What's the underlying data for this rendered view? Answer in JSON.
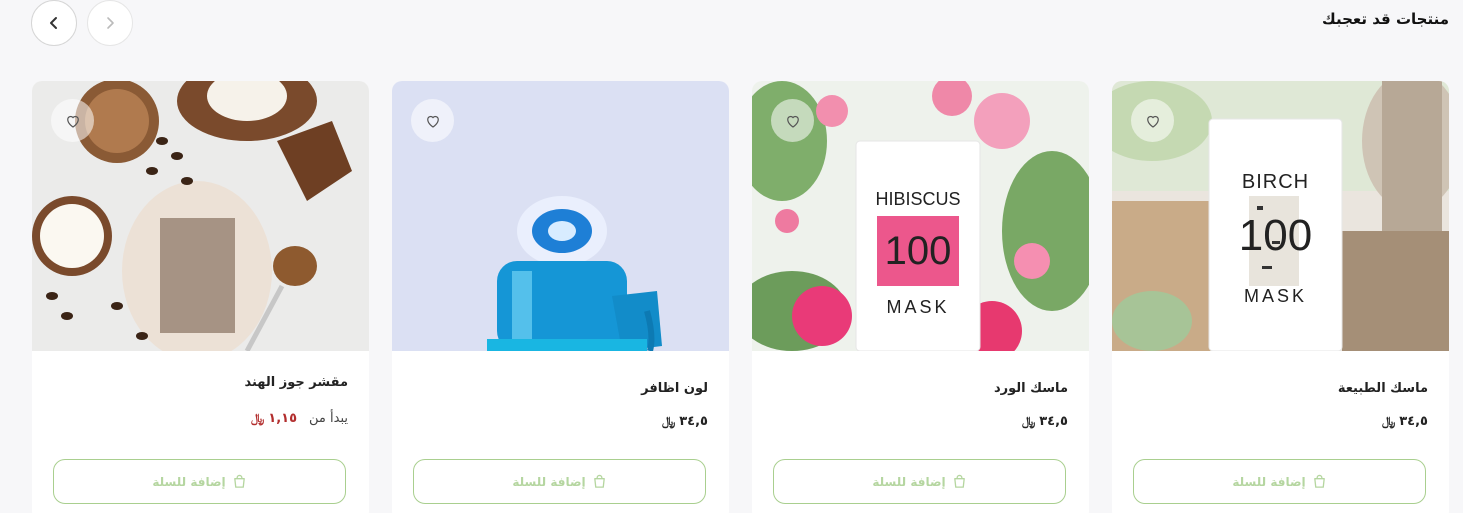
{
  "section": {
    "title": "منتجات قد تعجبك"
  },
  "nav": {
    "prev_icon": "chevron-left-icon",
    "next_icon": "chevron-right-icon"
  },
  "colors": {
    "accent": "#a9cf8f",
    "sale": "#b22d2d"
  },
  "products": [
    {
      "name": "ماسك الطبيعة",
      "price_prefix": "",
      "price": "٣٤,٥",
      "currency": "﷼",
      "sale": false,
      "add_label": "إضافة للسلة",
      "image_texts": {
        "top": "BIRCH",
        "number": "100",
        "bottom": "MASK"
      }
    },
    {
      "name": "ماسك الورد",
      "price_prefix": "",
      "price": "٣٤,٥",
      "currency": "﷼",
      "sale": false,
      "add_label": "إضافة للسلة",
      "image_texts": {
        "top": "HIBISCUS",
        "number": "100",
        "bottom": "MASK"
      }
    },
    {
      "name": "لون اظافر",
      "price_prefix": "",
      "price": "٣٤,٥",
      "currency": "﷼",
      "sale": false,
      "add_label": "إضافة للسلة"
    },
    {
      "name": "مقشر جوز الهند",
      "price_prefix": "يبدأ من",
      "price": "١,١٥",
      "currency": "﷼",
      "sale": true,
      "add_label": "إضافة للسلة"
    }
  ]
}
